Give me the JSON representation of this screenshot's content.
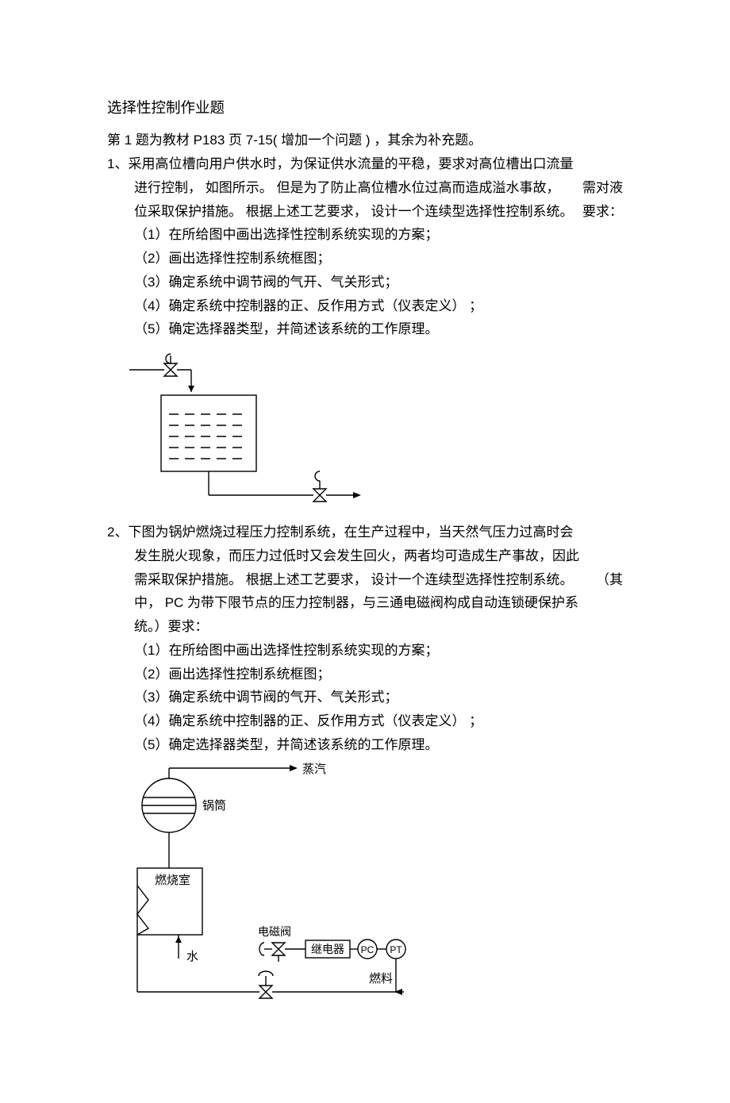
{
  "title": "选择性控制作业题",
  "intro": "第 1 题为教材 P183 页 7-15( 增加一个问题 ) ，其余为补充题。",
  "q1": {
    "num": "1、",
    "body1": "采用高位槽向用户供水时，为保证供水流量的平稳，要求对高位槽出口流量",
    "body2": "进行控制， 如图所示。 但是为了防止高位槽水位过高而造成溢水事故，",
    "body2_tail": "需对液",
    "body3": "位采取保护措施。 根据上述工艺要求， 设计一个连续型选择性控制系统。",
    "body3_tail": "要求：",
    "sub1": "（1）在所给图中画出选择性控制系统实现的方案；",
    "sub2": "（2）画出选择性控制系统框图；",
    "sub3": "（3）确定系统中调节阀的气开、气关形式；",
    "sub4": "（4）确定系统中控制器的正、反作用方式（仪表定义）    ；",
    "sub5": "（5）确定选择器类型，并简述该系统的工作原理。"
  },
  "q2": {
    "num": "2、",
    "body1": "下图为锅炉燃烧过程压力控制系统，在生产过程中，当天然气压力过高时会",
    "body2": "发生脱火现象，而压力过低时又会发生回火，两者均可造成生产事故，因此",
    "body3": "需采取保护措施。 根据上述工艺要求， 设计一个连续型选择性控制系统。",
    "body3_tail": "（其",
    "body4": "中， PC 为带下限节点的压力控制器，与三通电磁阀构成自动连锁硬保护系",
    "body5": "统。）要求：",
    "sub1": "（1）在所给图中画出选择性控制系统实现的方案；",
    "sub2": "（2）画出选择性控制系统框图；",
    "sub3": "（3）确定系统中调节阀的气开、气关形式；",
    "sub4": "（4）确定系统中控制器的正、反作用方式（仪表定义）    ；",
    "sub5": "（5）确定选择器类型，并简述该系统的工作原理。"
  },
  "labels": {
    "steam": "蒸汽",
    "drum": "锅筒",
    "combustion": "燃烧室",
    "water": "水",
    "solenoid": "电磁阀",
    "relay": "继电器",
    "pc": "PC",
    "pt": "PT",
    "fuel": "燃料"
  }
}
